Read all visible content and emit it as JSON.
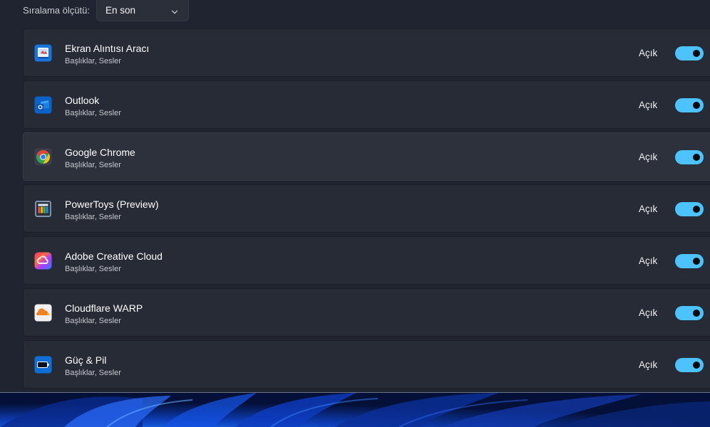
{
  "sort": {
    "label": "Sıralama ölçütü:",
    "value": "En son"
  },
  "apps": [
    {
      "name": "Ekran Alıntısı Aracı",
      "subtitle": "Başlıklar, Sesler",
      "state": "Açık",
      "on": true,
      "icon": "snipping-tool-icon"
    },
    {
      "name": "Outlook",
      "subtitle": "Başlıklar, Sesler",
      "state": "Açık",
      "on": true,
      "icon": "outlook-icon"
    },
    {
      "name": "Google Chrome",
      "subtitle": "Başlıklar, Sesler",
      "state": "Açık",
      "on": true,
      "icon": "chrome-icon"
    },
    {
      "name": "PowerToys (Preview)",
      "subtitle": "Başlıklar, Sesler",
      "state": "Açık",
      "on": true,
      "icon": "powertoys-icon"
    },
    {
      "name": "Adobe Creative Cloud",
      "subtitle": "Başlıklar, Sesler",
      "state": "Açık",
      "on": true,
      "icon": "creative-cloud-icon"
    },
    {
      "name": "Cloudflare WARP",
      "subtitle": "Başlıklar, Sesler",
      "state": "Açık",
      "on": true,
      "icon": "cloudflare-icon"
    },
    {
      "name": "Güç & Pil",
      "subtitle": "Başlıklar, Sesler",
      "state": "Açık",
      "on": true,
      "icon": "battery-icon"
    }
  ],
  "colors": {
    "accent": "#4cc2ff",
    "card": "#272b35",
    "background": "#1f2430"
  }
}
